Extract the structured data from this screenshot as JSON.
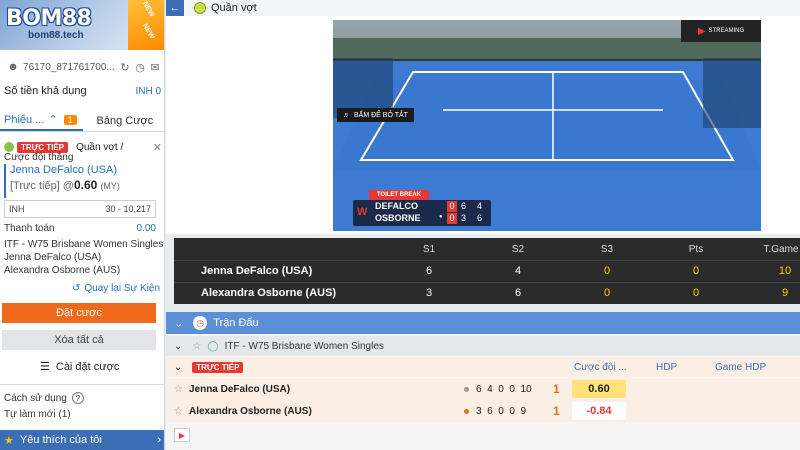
{
  "brand": {
    "name": "BOM88",
    "domain": "bom88.tech",
    "ribbon": "NEW"
  },
  "account": {
    "id": "76170_871761700...",
    "balance_label": "Số tiền khả dụng",
    "balance_value": "INH 0"
  },
  "betslip": {
    "tabs": [
      {
        "label": "Phiếu ...",
        "count": "1"
      },
      {
        "label": "Bảng Cược"
      }
    ],
    "live_badge": "TRỰC TIẾP",
    "sport": "Quần vợt /",
    "market": "Cược đội thắng",
    "selection": "Jenna DeFalco (USA)",
    "live_tag": "[Trực tiếp] @",
    "odds": "0.60",
    "odds_format": "(MY)",
    "stake_currency": "INH",
    "stake_range": "30 - 10,217",
    "payout_label": "Thanh toán",
    "payout_value": "0.00",
    "league": "ITF - W75 Brisbane Women Singles",
    "team1": "Jenna DeFalco (USA)",
    "team2": "Alexandra Osborne (AUS)",
    "back_link": "Quay lại Sự Kiện",
    "place_bet": "Đặt cược",
    "clear_all": "Xóa tất cả",
    "settings": "Cài đặt cược",
    "how_to": "Cách sử dụng",
    "self_new": "Tự làm mới (1)"
  },
  "favorites": {
    "label": "Yêu thích của tôi"
  },
  "topbar": {
    "title": "Quần vợt"
  },
  "video": {
    "banner": "BẤM ĐỂ BỎ TẮT",
    "overlay_title": "TOILET BREAK",
    "streaming": "STREAMING",
    "players": [
      {
        "name": "DEFALCO",
        "sets": [
          "0",
          "6",
          "4"
        ]
      },
      {
        "name": "OSBORNE",
        "sets": [
          "0",
          "3",
          "6"
        ]
      }
    ]
  },
  "scoreboard": {
    "headers": [
      "S1",
      "S2",
      "S3",
      "Pts",
      "T.Game"
    ],
    "rows": [
      {
        "name": "Jenna DeFalco (USA)",
        "s1": "6",
        "s2": "4",
        "s3": "0",
        "pts": "0",
        "tgame": "10"
      },
      {
        "name": "Alexandra Osborne (AUS)",
        "s1": "3",
        "s2": "6",
        "s3": "0",
        "pts": "0",
        "tgame": "9"
      }
    ]
  },
  "match_panel": {
    "title": "Trận Đấu",
    "league": "ITF - W75 Brisbane Women Singles",
    "live_badge": "TRỰC TIẾP",
    "col_odds": "Cược đội ...",
    "col_hdp": "HDP",
    "col_game_hdp": "Game HDP",
    "rows": [
      {
        "name": "Jenna DeFalco (USA)",
        "scores": "6  4  0  0  10",
        "last": "1",
        "odds": "0.60"
      },
      {
        "name": "Alexandra Osborne (AUS)",
        "scores": "3  6  0  0  9",
        "last": "1",
        "odds": "-0.84"
      }
    ]
  },
  "colors": {
    "accent": "#3b6eb5",
    "live": "#e53935",
    "orange": "#ee6a1a",
    "highlight": "#ffd400"
  }
}
